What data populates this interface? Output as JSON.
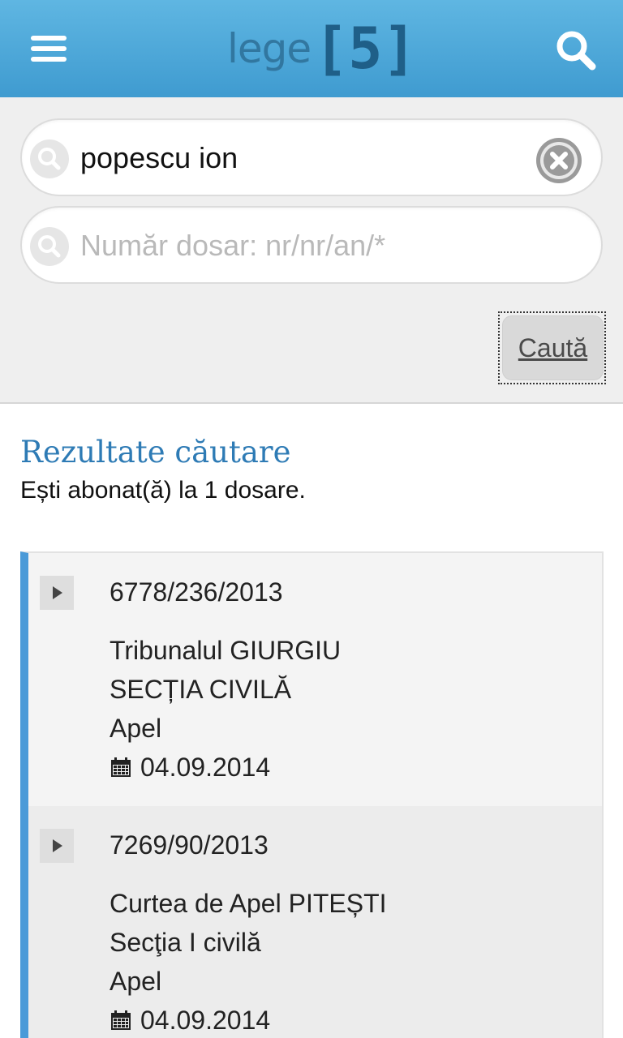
{
  "header": {
    "logo_word": "lege",
    "logo_number": "[5]",
    "menu_icon": "hamburger-menu-icon",
    "search_icon": "search-icon"
  },
  "search": {
    "name_value": "popescu ion",
    "case_placeholder": "Număr dosar: nr/nr/an/*",
    "submit_label": "Caută"
  },
  "results": {
    "title": "Rezultate căutare",
    "subtitle": "Ești abonat(ă) la 1 dosare.",
    "items": [
      {
        "case_number": "6778/236/2013",
        "court": "Tribunalul GIURGIU",
        "section": "SECȚIA CIVILĂ",
        "stage": "Apel",
        "date": "04.09.2014"
      },
      {
        "case_number": "7269/90/2013",
        "court": "Curtea de Apel PITEȘTI",
        "section": "Secţia I civilă",
        "stage": "Apel",
        "date": "04.09.2014"
      }
    ]
  },
  "colors": {
    "header_blue": "#4aa6d9",
    "accent_blue": "#4a9ad8",
    "title_blue": "#2e7bb5"
  }
}
